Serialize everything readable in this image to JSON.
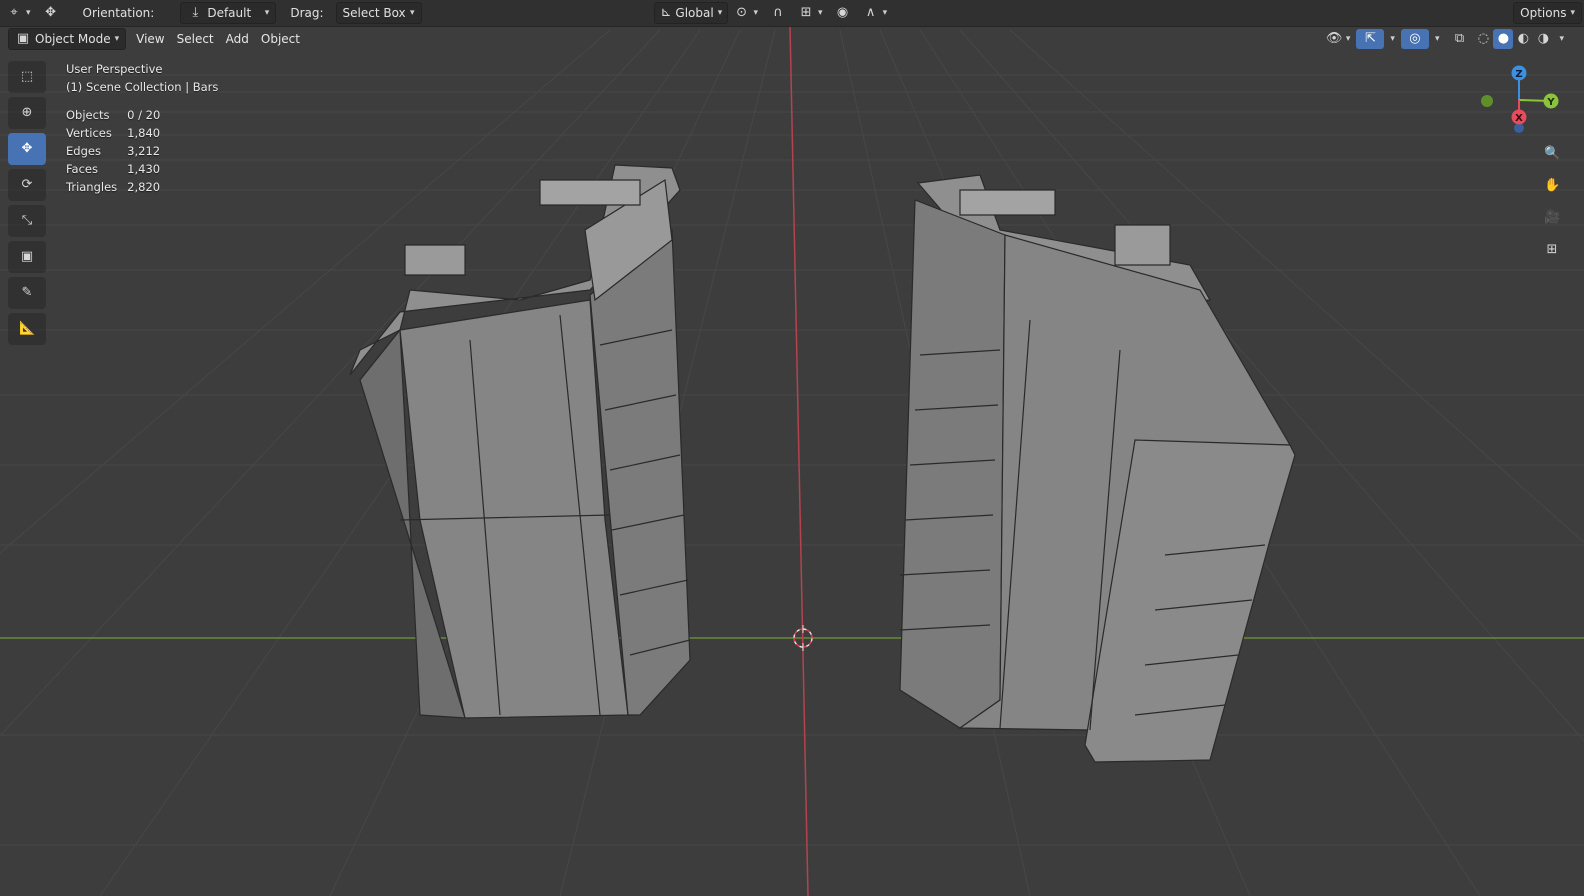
{
  "header": {
    "orientation_label": "Orientation:",
    "orientation_value": "Default",
    "drag_label": "Drag:",
    "drag_value": "Select Box",
    "transform_space": "Global",
    "options_label": "Options"
  },
  "menubar": {
    "mode": "Object Mode",
    "view": "View",
    "select": "Select",
    "add": "Add",
    "object": "Object"
  },
  "overlay": {
    "perspective": "User Perspective",
    "collection": "(1) Scene Collection | Bars",
    "stats": [
      {
        "label": "Objects",
        "value": "0 / 20"
      },
      {
        "label": "Vertices",
        "value": "1,840"
      },
      {
        "label": "Edges",
        "value": "3,212"
      },
      {
        "label": "Faces",
        "value": "1,430"
      },
      {
        "label": "Triangles",
        "value": "2,820"
      }
    ]
  },
  "gizmo": {
    "z": "Z",
    "y": "Y",
    "x": "X"
  },
  "toolbar": {
    "tools": [
      "select-box-icon",
      "cursor-icon",
      "move-icon",
      "rotate-icon",
      "scale-icon",
      "transform-icon",
      "annotate-icon",
      "measure-icon"
    ],
    "active": "move-icon"
  },
  "colors": {
    "accent": "#4772b3",
    "x_axis": "#e84a5f",
    "y_axis": "#8bc43a",
    "z_axis": "#3d8fe0"
  }
}
